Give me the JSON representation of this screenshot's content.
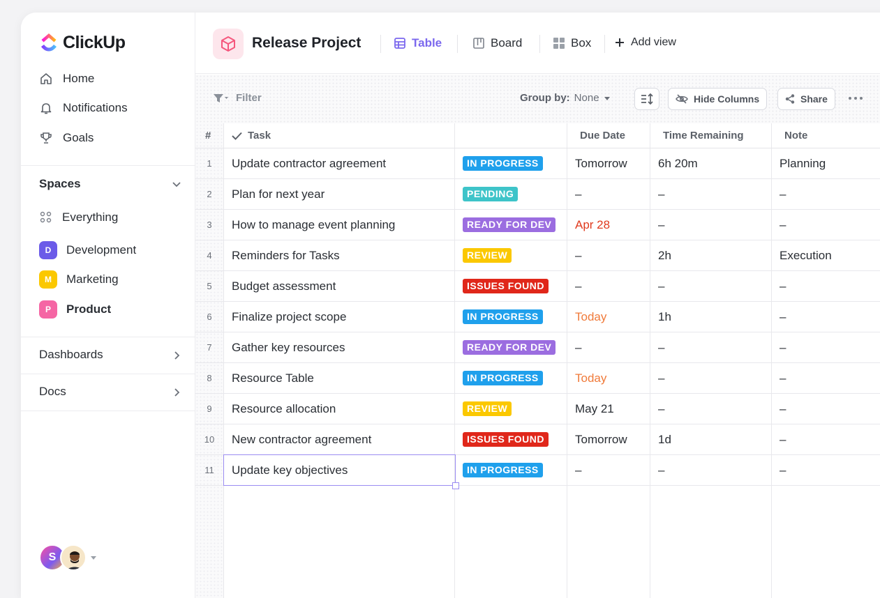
{
  "app": {
    "name": "ClickUp"
  },
  "sidebar": {
    "nav": [
      {
        "label": "Home",
        "icon": "home-icon"
      },
      {
        "label": "Notifications",
        "icon": "bell-icon"
      },
      {
        "label": "Goals",
        "icon": "trophy-icon"
      }
    ],
    "spaces_label": "Spaces",
    "everything_label": "Everything",
    "spaces": [
      {
        "letter": "D",
        "label": "Development",
        "color": "#6b5be8"
      },
      {
        "letter": "M",
        "label": "Marketing",
        "color": "#fbc800"
      },
      {
        "letter": "P",
        "label": "Product",
        "color": "#f566a4"
      }
    ],
    "dashboards_label": "Dashboards",
    "docs_label": "Docs",
    "user_initial": "S"
  },
  "header": {
    "project_title": "Release Project",
    "views": [
      {
        "label": "Table",
        "icon": "table-icon",
        "active": true
      },
      {
        "label": "Board",
        "icon": "board-icon",
        "active": false
      },
      {
        "label": "Box",
        "icon": "box-icon",
        "active": false
      }
    ],
    "add_view_label": "Add view"
  },
  "toolbar": {
    "filter_label": "Filter",
    "group_by_label": "Group by:",
    "group_by_value": "None",
    "hide_columns_label": "Hide Columns",
    "share_label": "Share"
  },
  "table": {
    "columns": [
      "#",
      "Task",
      "",
      "Due Date",
      "Time Remaining",
      "Note"
    ],
    "status_colors": {
      "IN PROGRESS": "#1fa0ec",
      "PENDING": "#3ec4c9",
      "READY FOR DEV": "#9b6de0",
      "REVIEW": "#fbc800",
      "ISSUES FOUND": "#e0271a"
    },
    "rows": [
      {
        "n": "1",
        "task": "Update contractor agreement",
        "status": "IN PROGRESS",
        "due": "Tomorrow",
        "due_color": "#2a2e34",
        "time": "6h 20m",
        "note": "Planning"
      },
      {
        "n": "2",
        "task": "Plan for next year",
        "status": "PENDING",
        "due": "–",
        "due_color": "#2a2e34",
        "time": "–",
        "note": "–"
      },
      {
        "n": "3",
        "task": "How to manage event planning",
        "status": "READY FOR DEV",
        "due": "Apr 28",
        "due_color": "#e03a1e",
        "time": "–",
        "note": "–"
      },
      {
        "n": "4",
        "task": "Reminders for Tasks",
        "status": "REVIEW",
        "due": "–",
        "due_color": "#2a2e34",
        "time": "2h",
        "note": "Execution"
      },
      {
        "n": "5",
        "task": "Budget assessment",
        "status": "ISSUES FOUND",
        "due": "–",
        "due_color": "#2a2e34",
        "time": "–",
        "note": "–"
      },
      {
        "n": "6",
        "task": "Finalize project scope",
        "status": "IN PROGRESS",
        "due": "Today",
        "due_color": "#f07a3a",
        "time": "1h",
        "note": "–"
      },
      {
        "n": "7",
        "task": "Gather key resources",
        "status": "READY FOR DEV",
        "due": "–",
        "due_color": "#2a2e34",
        "time": "–",
        "note": "–"
      },
      {
        "n": "8",
        "task": "Resource Table",
        "status": "IN PROGRESS",
        "due": "Today",
        "due_color": "#f07a3a",
        "time": "–",
        "note": "–"
      },
      {
        "n": "9",
        "task": "Resource allocation",
        "status": "REVIEW",
        "due": "May 21",
        "due_color": "#2a2e34",
        "time": "–",
        "note": "–"
      },
      {
        "n": "10",
        "task": "New contractor agreement",
        "status": "ISSUES FOUND",
        "due": "Tomorrow",
        "due_color": "#2a2e34",
        "time": "1d",
        "note": "–"
      },
      {
        "n": "11",
        "task": "Update key objectives",
        "status": "IN PROGRESS",
        "due": "–",
        "due_color": "#2a2e34",
        "time": "–",
        "note": "–"
      }
    ]
  }
}
